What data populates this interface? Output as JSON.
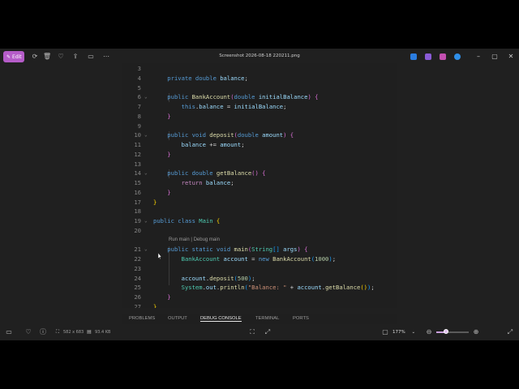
{
  "titlebar": {
    "edit_label": "Edit",
    "title": "Screenshot 2026-08-18 220211.png",
    "icons": [
      "rotate-icon",
      "delete-icon",
      "favorite-icon",
      "share-icon",
      "slideshow-icon",
      "more-icon"
    ],
    "app_icons": [
      "paint-app-icon",
      "clipchamp-app-icon",
      "designer-app-icon",
      "onedrive-app-icon"
    ]
  },
  "editor": {
    "lines": [
      {
        "n": "3",
        "segs": []
      },
      {
        "n": "4",
        "segs": [
          [
            "kb",
            "    private double "
          ],
          [
            "va",
            "balance"
          ],
          [
            "pl",
            ";"
          ]
        ]
      },
      {
        "n": "5",
        "segs": []
      },
      {
        "n": "6",
        "segs": [
          [
            "kb",
            "    public "
          ],
          [
            "fn",
            "BankAccount"
          ],
          [
            "br2",
            "("
          ],
          [
            "kb",
            "double "
          ],
          [
            "va",
            "initialBalance"
          ],
          [
            "br2",
            ")"
          ],
          [
            "pl",
            " "
          ],
          [
            "br2",
            "{"
          ]
        ]
      },
      {
        "n": "7",
        "segs": [
          [
            "kb",
            "        this"
          ],
          [
            "pl",
            "."
          ],
          [
            "va",
            "balance"
          ],
          [
            "pl",
            " = "
          ],
          [
            "va",
            "initialBalance"
          ],
          [
            "pl",
            ";"
          ]
        ]
      },
      {
        "n": "8",
        "segs": [
          [
            "br2",
            "    }"
          ]
        ]
      },
      {
        "n": "9",
        "segs": []
      },
      {
        "n": "10",
        "segs": [
          [
            "kb",
            "    public void "
          ],
          [
            "fn",
            "deposit"
          ],
          [
            "br2",
            "("
          ],
          [
            "kb",
            "double "
          ],
          [
            "va",
            "amount"
          ],
          [
            "br2",
            ")"
          ],
          [
            "pl",
            " "
          ],
          [
            "br2",
            "{"
          ]
        ]
      },
      {
        "n": "11",
        "segs": [
          [
            "va",
            "        balance"
          ],
          [
            "pl",
            " += "
          ],
          [
            "va",
            "amount"
          ],
          [
            "pl",
            ";"
          ]
        ]
      },
      {
        "n": "12",
        "segs": [
          [
            "br2",
            "    }"
          ]
        ]
      },
      {
        "n": "13",
        "segs": []
      },
      {
        "n": "14",
        "segs": [
          [
            "kb",
            "    public double "
          ],
          [
            "fn",
            "getBalance"
          ],
          [
            "br2",
            "()"
          ],
          [
            "pl",
            " "
          ],
          [
            "br2",
            "{"
          ]
        ]
      },
      {
        "n": "15",
        "segs": [
          [
            "kw",
            "        return "
          ],
          [
            "va",
            "balance"
          ],
          [
            "pl",
            ";"
          ]
        ]
      },
      {
        "n": "16",
        "segs": [
          [
            "br2",
            "    }"
          ]
        ]
      },
      {
        "n": "17",
        "segs": [
          [
            "br1",
            "}"
          ]
        ]
      },
      {
        "n": "18",
        "segs": []
      },
      {
        "n": "19",
        "segs": [
          [
            "kb",
            "public class "
          ],
          [
            "ty",
            "Main"
          ],
          [
            "pl",
            " "
          ],
          [
            "br1",
            "{"
          ]
        ]
      },
      {
        "n": "20",
        "segs": []
      },
      {
        "n": "",
        "segs": [],
        "lens": "Run main | Debug main"
      },
      {
        "n": "21",
        "segs": [
          [
            "kb",
            "    public static void "
          ],
          [
            "fn",
            "main"
          ],
          [
            "br2",
            "("
          ],
          [
            "ty",
            "String"
          ],
          [
            "br3",
            "[]"
          ],
          [
            "pl",
            " "
          ],
          [
            "va",
            "args"
          ],
          [
            "br2",
            ")"
          ],
          [
            "pl",
            " "
          ],
          [
            "br2",
            "{"
          ]
        ]
      },
      {
        "n": "22",
        "segs": [
          [
            "ty",
            "        BankAccount "
          ],
          [
            "va",
            "account"
          ],
          [
            "pl",
            " = "
          ],
          [
            "kb",
            "new "
          ],
          [
            "fn",
            "BankAccount"
          ],
          [
            "br3",
            "("
          ],
          [
            "nu",
            "1000"
          ],
          [
            "br3",
            ")"
          ],
          [
            "pl",
            ";"
          ]
        ]
      },
      {
        "n": "23",
        "segs": []
      },
      {
        "n": "24",
        "segs": [
          [
            "va",
            "        account"
          ],
          [
            "pl",
            "."
          ],
          [
            "fn",
            "deposit"
          ],
          [
            "br3",
            "("
          ],
          [
            "nu",
            "500"
          ],
          [
            "br3",
            ")"
          ],
          [
            "pl",
            ";"
          ]
        ]
      },
      {
        "n": "25",
        "segs": [
          [
            "ty",
            "        System"
          ],
          [
            "pl",
            "."
          ],
          [
            "va",
            "out"
          ],
          [
            "pl",
            "."
          ],
          [
            "fn",
            "println"
          ],
          [
            "br3",
            "("
          ],
          [
            "st",
            "\"Balance: \""
          ],
          [
            "pl",
            " + "
          ],
          [
            "va",
            "account"
          ],
          [
            "pl",
            "."
          ],
          [
            "fn",
            "getBalance"
          ],
          [
            "br1",
            "()"
          ],
          [
            "br3",
            ")"
          ],
          [
            "pl",
            ";"
          ]
        ]
      },
      {
        "n": "26",
        "segs": [
          [
            "br2",
            "    }"
          ]
        ]
      },
      {
        "n": "27",
        "segs": [
          [
            "br1",
            "}"
          ]
        ]
      }
    ],
    "fold_lines": [
      "6",
      "10",
      "14",
      "19",
      "21"
    ]
  },
  "panel": {
    "tabs": [
      "PROBLEMS",
      "OUTPUT",
      "DEBUG CONSOLE",
      "TERMINAL",
      "PORTS"
    ],
    "active": "DEBUG CONSOLE"
  },
  "statusbar": {
    "dimensions": "582 x 683",
    "size": "93.4 KB",
    "zoom": "177%",
    "zoom_fraction": 0.3
  },
  "colors": {
    "accent": "#b55cc8",
    "background": "#202020",
    "editor_bg": "#1f1f1f"
  }
}
